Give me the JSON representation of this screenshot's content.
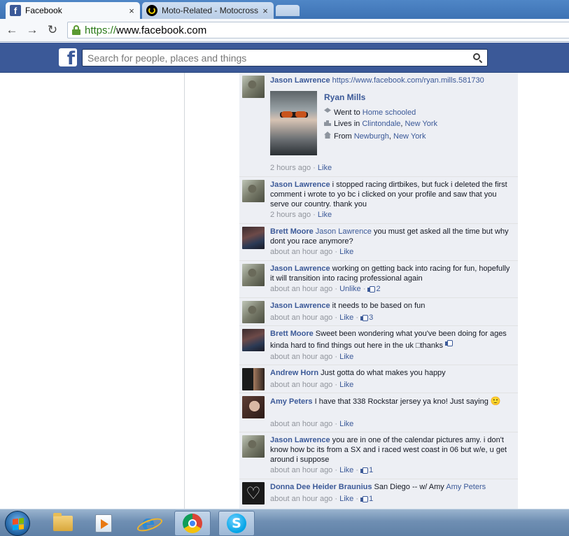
{
  "browser": {
    "tabs": [
      {
        "title": "Facebook",
        "close": "×"
      },
      {
        "title": "Moto-Related - Motocross",
        "close": "×"
      }
    ],
    "favicon_fb": "f",
    "url_scheme": "https://",
    "url_host": "www.facebook.com"
  },
  "fb": {
    "logo": "f",
    "search_placeholder": "Search for people, places and things"
  },
  "colors": {
    "fb_blue": "#3b5998",
    "link": "#3b5998",
    "meta_gray": "#90949c"
  },
  "shared_post": {
    "author": "Jason Lawrence",
    "url": "https://www.facebook.com/ryan.mills.581730",
    "profile_name": "Ryan Mills",
    "went_to_prefix": "Went to",
    "went_to": "Home schooled",
    "lives_prefix": "Lives in",
    "lives_city": "Clintondale",
    "lives_sep": ",",
    "lives_state": "New York",
    "from_prefix": "From",
    "from_city": "Newburgh",
    "from_sep": ",",
    "from_state": "New York",
    "time": "2 hours ago",
    "dot": "·",
    "action": "Like"
  },
  "comments": [
    {
      "author": "Jason Lawrence",
      "text": "i stopped racing dirtbikes, but fuck i deleted the first comment i wrote to yo bc i clicked on your profile and saw that you serve our country. thank you",
      "time": "2 hours ago",
      "dot": "·",
      "action": "Like",
      "likes": ""
    },
    {
      "author": "Brett Moore",
      "mention": "Jason Lawrence",
      "text": "you must get asked all the time but why dont you race anymore?",
      "time": "about an hour ago",
      "dot": "·",
      "action": "Like",
      "likes": ""
    },
    {
      "author": "Jason Lawrence",
      "text": "working on getting back into racing for fun, hopefully it will transition into racing professional again",
      "time": "about an hour ago",
      "dot": "·",
      "action": "Unlike",
      "dot2": "·",
      "likes": "2"
    },
    {
      "author": "Jason Lawrence",
      "text": "it needs to be based on fun",
      "time": "about an hour ago",
      "dot": "·",
      "action": "Like",
      "dot2": "·",
      "likes": "3"
    },
    {
      "author": "Brett Moore",
      "text": "Sweet been wondering what you've been doing for ages kinda hard to find things out here in the uk □thanks",
      "time": "about an hour ago",
      "dot": "·",
      "action": "Like",
      "likes": ""
    },
    {
      "author": "Andrew Horn",
      "text": "Just gotta do what makes you happy",
      "time": "about an hour ago",
      "dot": "·",
      "action": "Like",
      "likes": ""
    },
    {
      "author": "Amy Peters",
      "text": "I have that 338 Rockstar jersey ya kno! Just saying",
      "emoji": "🙂",
      "time": "about an hour ago",
      "dot": "·",
      "action": "Like",
      "likes": ""
    },
    {
      "author": "Jason Lawrence",
      "text": "you are in one of the calendar pictures amy. i don't know how bc its from a SX and i raced west coast in 06 but w/e, u get around i suppose",
      "time": "about an hour ago",
      "dot": "·",
      "action": "Like",
      "dot2": "·",
      "likes": "1"
    },
    {
      "author": "Donna Dee Heider Braunius",
      "text": "San Diego -- w/ Amy",
      "mention": "Amy Peters",
      "time": "about an hour ago",
      "dot": "·",
      "action": "Like",
      "dot2": "·",
      "likes": "1"
    }
  ],
  "taskbar": {
    "ie_glyph": "e",
    "skype_glyph": "S"
  }
}
